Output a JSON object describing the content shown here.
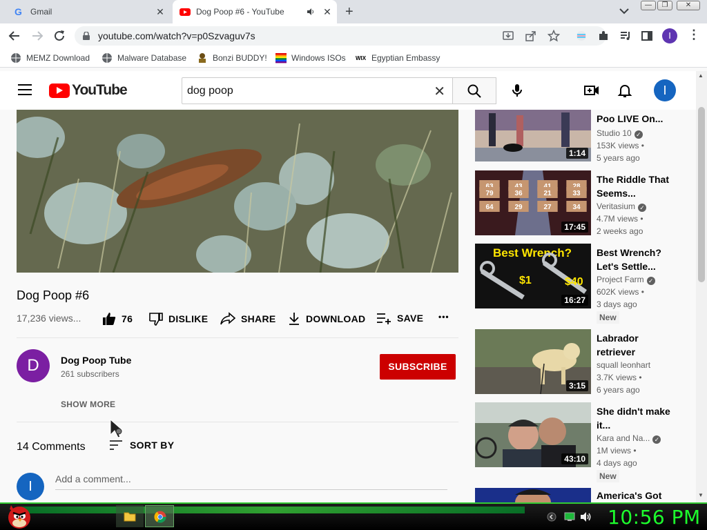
{
  "browser": {
    "tabs": [
      {
        "label": "Gmail",
        "close": "✕"
      },
      {
        "label": "Dog Poop #6 - YouTube",
        "close": "✕"
      }
    ],
    "url": "youtube.com/watch?v=p0Szvaguv7s",
    "bookmarks": [
      {
        "label": "MEMZ Download"
      },
      {
        "label": "Malware Database"
      },
      {
        "label": "Bonzi BUDDY!"
      },
      {
        "label": "Windows ISOs"
      },
      {
        "label": "Egyptian Embassy"
      }
    ]
  },
  "header": {
    "logo_text": "YouTube",
    "search_value": "dog poop",
    "avatar_letter": "I"
  },
  "video": {
    "title": "Dog Poop #6",
    "views": "17,236 views...",
    "likes": "76",
    "dislike_label": "DISLIKE",
    "share_label": "SHARE",
    "download_label": "DOWNLOAD",
    "save_label": "SAVE",
    "more_label": "•••"
  },
  "channel": {
    "avatar_letter": "D",
    "name": "Dog Poop Tube",
    "subscribers": "261 subscribers",
    "subscribe_label": "SUBSCRIBE",
    "show_more": "SHOW MORE"
  },
  "comments": {
    "count": "14 Comments",
    "sort_label": "SORT BY",
    "me_avatar": "I",
    "placeholder": "Add a comment..."
  },
  "related": [
    {
      "title": "Poo LIVE On...",
      "channel": "Studio 10",
      "verified": true,
      "views": "153K views •",
      "age": "5 years ago",
      "duration": "1:14",
      "badge": ""
    },
    {
      "title": "The Riddle That Seems...",
      "channel": "Veritasium",
      "verified": true,
      "views": "4.7M views •",
      "age": "2 weeks ago",
      "duration": "17:45",
      "badge": ""
    },
    {
      "title": "Best Wrench? Let's Settle...",
      "channel": "Project Farm",
      "verified": true,
      "views": "602K views •",
      "age": "3 days ago",
      "duration": "16:27",
      "badge": "New",
      "thumb_text": "Best Wrench?",
      "price1": "$1",
      "price2": "$40"
    },
    {
      "title": "Labrador retriever",
      "channel": "squall leonhart",
      "verified": false,
      "views": "3.7K views •",
      "age": "6 years ago",
      "duration": "3:15",
      "badge": ""
    },
    {
      "title": "She didn't make it...",
      "channel": "Kara and Na...",
      "verified": true,
      "views": "1M views •",
      "age": "4 days ago",
      "duration": "43:10",
      "badge": "New"
    },
    {
      "title": "America's Got",
      "channel": "",
      "verified": false,
      "views": "",
      "age": "",
      "duration": "",
      "badge": ""
    }
  ],
  "riddle_numbers": [
    "63",
    "43",
    "41",
    "28",
    "79",
    "36",
    "21",
    "33",
    "64",
    "29",
    "27",
    "34"
  ],
  "taskbar": {
    "clock": "10:56 PM"
  },
  "colors": {
    "yt_red": "#ff0000",
    "subscribe_red": "#cc0000",
    "avatar_blue": "#1565c0",
    "channel_purple": "#7b1fa2",
    "clock_green": "#1dff2d"
  }
}
